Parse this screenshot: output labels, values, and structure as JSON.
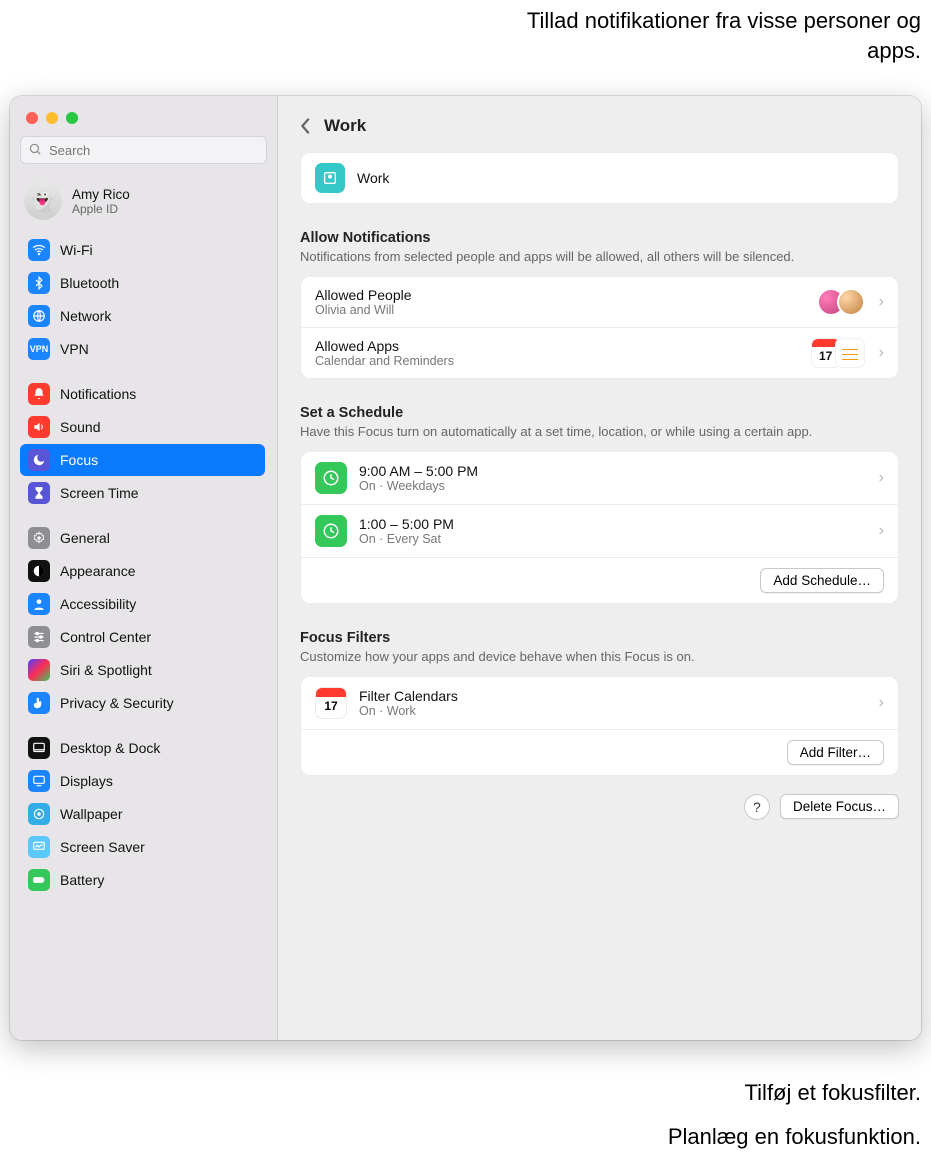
{
  "annotations": {
    "top": "Tillad notifikationer fra visse personer og apps.",
    "filter": "Tilføj et fokusfilter.",
    "schedule": "Planlæg en fokusfunktion."
  },
  "search": {
    "placeholder": "Search"
  },
  "account": {
    "name": "Amy Rico",
    "sub": "Apple ID"
  },
  "sidebar": {
    "g1": [
      {
        "label": "Wi-Fi",
        "icon": "wifi",
        "color": "blue"
      },
      {
        "label": "Bluetooth",
        "icon": "bluetooth",
        "color": "blue"
      },
      {
        "label": "Network",
        "icon": "globe",
        "color": "blue"
      },
      {
        "label": "VPN",
        "icon": "vpn",
        "color": "blue"
      }
    ],
    "g2": [
      {
        "label": "Notifications",
        "icon": "bell",
        "color": "red"
      },
      {
        "label": "Sound",
        "icon": "speaker",
        "color": "red"
      },
      {
        "label": "Focus",
        "icon": "moon",
        "color": "purple",
        "selected": true
      },
      {
        "label": "Screen Time",
        "icon": "hourglass",
        "color": "purple"
      }
    ],
    "g3": [
      {
        "label": "General",
        "icon": "gear",
        "color": "gray"
      },
      {
        "label": "Appearance",
        "icon": "appearance",
        "color": "black"
      },
      {
        "label": "Accessibility",
        "icon": "person",
        "color": "blue"
      },
      {
        "label": "Control Center",
        "icon": "sliders",
        "color": "gray"
      },
      {
        "label": "Siri & Spotlight",
        "icon": "siri",
        "color": "siri"
      },
      {
        "label": "Privacy & Security",
        "icon": "hand",
        "color": "blue"
      }
    ],
    "g4": [
      {
        "label": "Desktop & Dock",
        "icon": "dock",
        "color": "black"
      },
      {
        "label": "Displays",
        "icon": "display",
        "color": "blue"
      },
      {
        "label": "Wallpaper",
        "icon": "wallpaper",
        "color": "teal"
      },
      {
        "label": "Screen Saver",
        "icon": "screensaver",
        "color": "cyan"
      },
      {
        "label": "Battery",
        "icon": "battery",
        "color": "green"
      }
    ]
  },
  "header": {
    "title": "Work"
  },
  "focus_name_row": {
    "label": "Work"
  },
  "allow": {
    "title": "Allow Notifications",
    "desc": "Notifications from selected people and apps will be allowed, all others will be silenced.",
    "people": {
      "title": "Allowed People",
      "sub": "Olivia and Will"
    },
    "apps": {
      "title": "Allowed Apps",
      "sub": "Calendar and Reminders"
    }
  },
  "schedule": {
    "title": "Set a Schedule",
    "desc": "Have this Focus turn on automatically at a set time, location, or while using a certain app.",
    "rows": [
      {
        "title": "9:00 AM – 5:00 PM",
        "sub": "On · Weekdays"
      },
      {
        "title": "1:00 – 5:00 PM",
        "sub": "On · Every Sat"
      }
    ],
    "add": "Add Schedule…"
  },
  "filters": {
    "title": "Focus Filters",
    "desc": "Customize how your apps and device behave when this Focus is on.",
    "row": {
      "title": "Filter Calendars",
      "sub": "On · Work"
    },
    "add": "Add Filter…"
  },
  "delete": "Delete Focus…",
  "help": "?"
}
